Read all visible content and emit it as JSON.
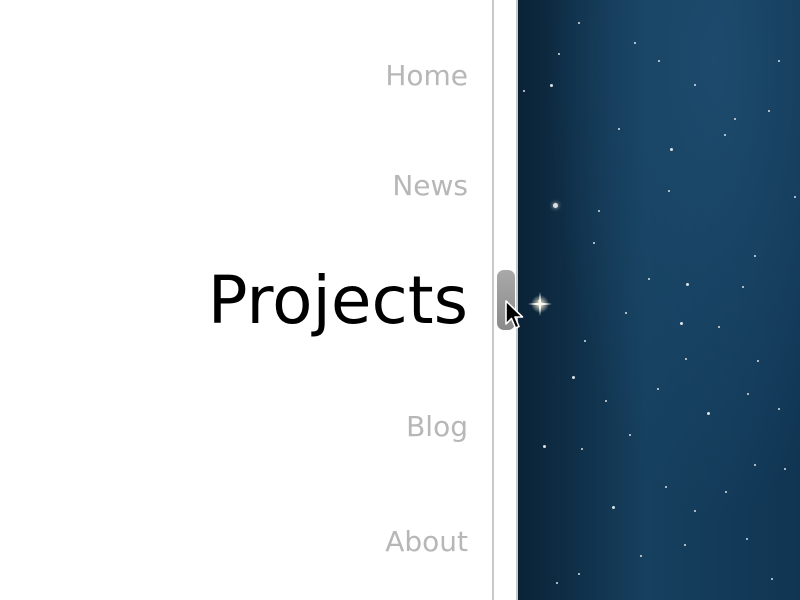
{
  "nav": {
    "items": [
      {
        "label": "Home"
      },
      {
        "label": "News"
      },
      {
        "label": "Projects"
      },
      {
        "label": "Blog"
      },
      {
        "label": "About"
      }
    ]
  },
  "colors": {
    "inactive_text": "#b7b7b7",
    "active_text": "#000000",
    "sky": "#163f5f"
  },
  "icons": {
    "cursor": "pointer-cursor-icon",
    "sparkle": "sparkle-star-icon"
  }
}
